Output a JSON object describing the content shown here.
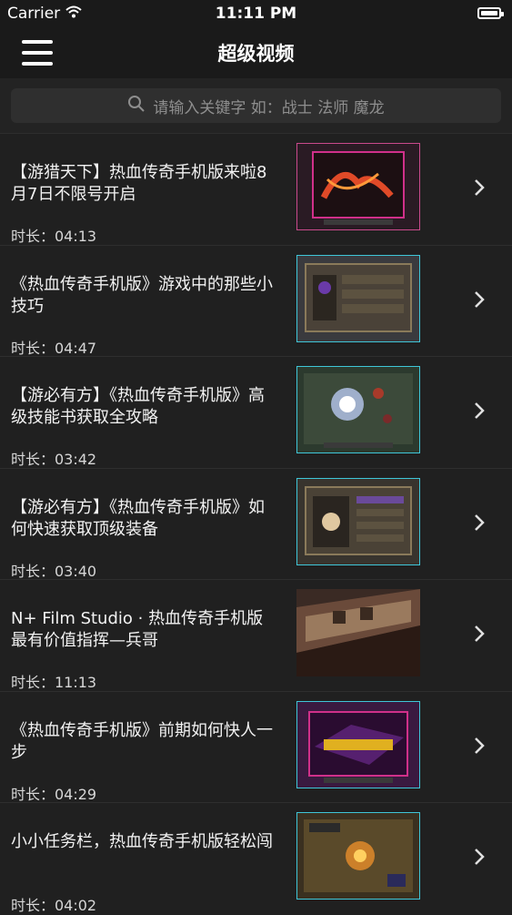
{
  "status": {
    "carrier": "Carrier",
    "time": "11:11 PM"
  },
  "nav": {
    "title": "超级视频",
    "menu_icon": "hamburger-menu-icon"
  },
  "search": {
    "placeholder": "请输入关键字 如：战士 法师 魔龙",
    "icon": "search-icon"
  },
  "videos": [
    {
      "title": "【游猎天下】热血传奇手机版来啦8月7日不限号开启",
      "duration": "时长：04:13"
    },
    {
      "title": "《热血传奇手机版》游戏中的那些小技巧",
      "duration": "时长：04:47"
    },
    {
      "title": "【游必有方】《热血传奇手机版》高级技能书获取全攻略",
      "duration": "时长：03:42"
    },
    {
      "title": "【游必有方】《热血传奇手机版》如何快速获取顶级装备",
      "duration": "时长：03:40"
    },
    {
      "title": "N+ Film Studio · 热血传奇手机版最有价值指挥—兵哥",
      "duration": "时长：11:13"
    },
    {
      "title": "《热血传奇手机版》前期如何快人一步",
      "duration": "时长：04:29"
    },
    {
      "title": "小小任务栏，热血传奇手机版轻松闯",
      "duration": "时长：04:02"
    }
  ],
  "colors": {
    "background": "#202020",
    "bar": "#1a1a1a",
    "search_field": "#2f2f2f",
    "divider": "#2e2e2e",
    "thumb_frame": "#3fc6d8",
    "thumb_accent": "#d0308a"
  }
}
